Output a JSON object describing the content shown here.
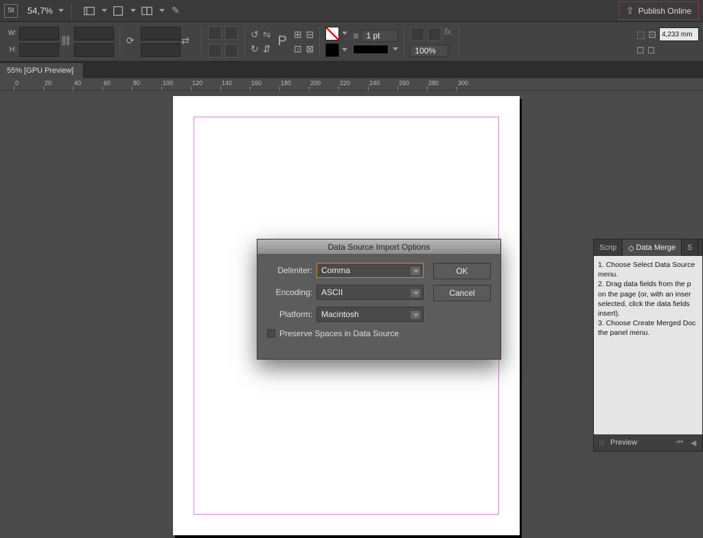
{
  "top": {
    "app_badge": "St",
    "zoom": "54,7%",
    "publish": "Publish Online"
  },
  "control": {
    "w_label": "W:",
    "h_label": "H:",
    "stroke_pt": "1 pt",
    "opacity": "100%",
    "mm": "4,233 mm"
  },
  "tab": {
    "doc": "55% [GPU Preview]"
  },
  "ruler_ticks": [
    0,
    20,
    40,
    60,
    80,
    100,
    120,
    140,
    160,
    180,
    200,
    220,
    240,
    260,
    280,
    300
  ],
  "dialog": {
    "title": "Data Source Import Options",
    "delimiter_label": "Delimiter:",
    "delimiter_value": "Comma",
    "encoding_label": "Encoding:",
    "encoding_value": "ASCII",
    "platform_label": "Platform:",
    "platform_value": "Macintosh",
    "preserve": "Preserve Spaces in Data Source",
    "ok": "OK",
    "cancel": "Cancel"
  },
  "panel": {
    "tab1": "Scrip",
    "tab2": "Data Merge",
    "tab3": "S",
    "step1": "1. Choose Select Data Source menu.",
    "step2": "2. Drag data fields from the p on the page (or, with an inser selected, click the data fields insert).",
    "step3": "3. Choose Create Merged Doc the panel menu.",
    "preview": "Preview"
  }
}
